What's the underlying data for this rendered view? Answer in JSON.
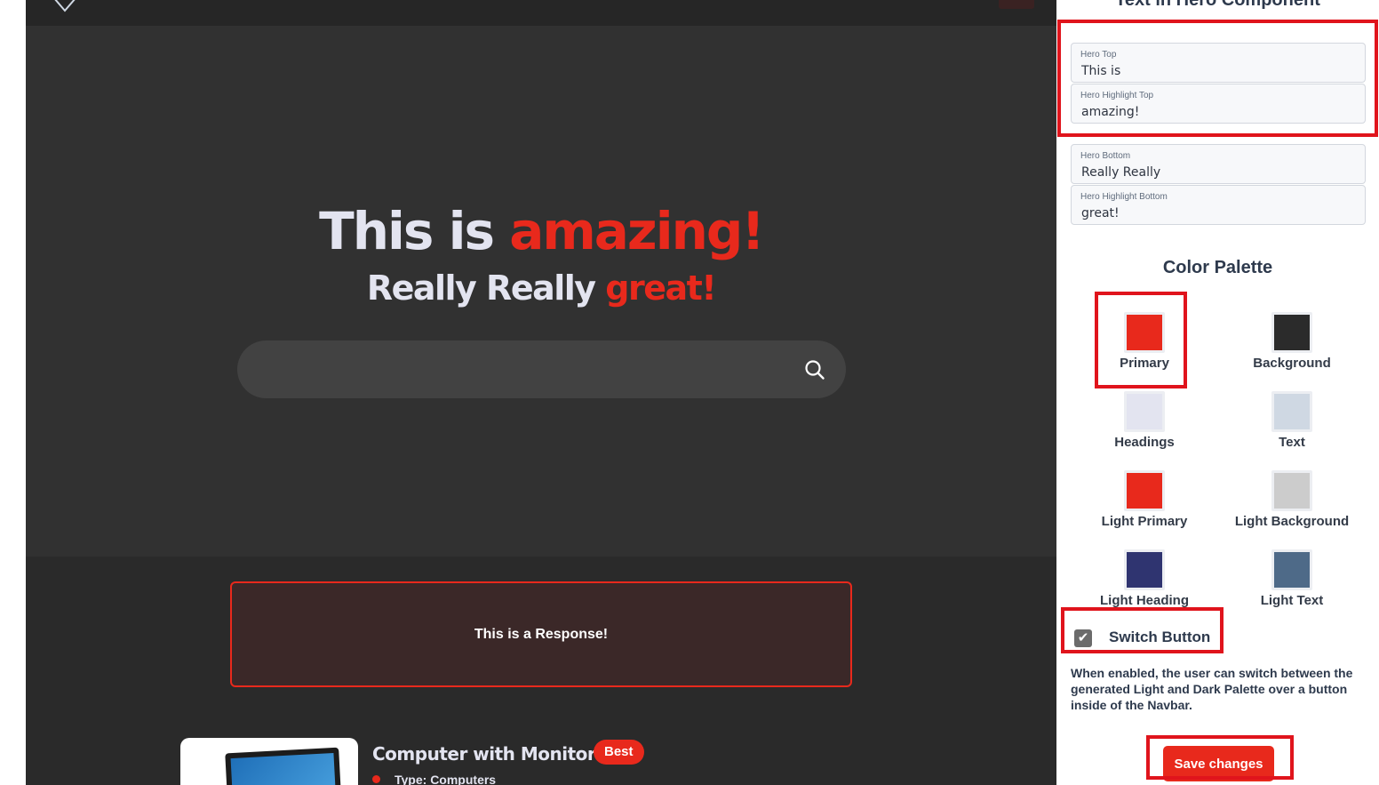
{
  "hero": {
    "top": "This is",
    "highlight_top": "amazing!",
    "bottom": "Really Really",
    "highlight_bottom": "great!"
  },
  "search": {
    "placeholder": ""
  },
  "response": {
    "text": "This is a Response!"
  },
  "product": {
    "title": "Computer with Monitor",
    "badge": "Best",
    "type": "Type: Computers"
  },
  "panel": {
    "title": "Text in Hero Component",
    "fields": [
      {
        "label": "Hero Top",
        "value": "This is"
      },
      {
        "label": "Hero Highlight Top",
        "value": "amazing!"
      },
      {
        "label": "Hero Bottom",
        "value": "Really Really"
      },
      {
        "label": "Hero Highlight Bottom",
        "value": "great!"
      }
    ],
    "palette_title": "Color Palette",
    "palette": [
      {
        "label": "Primary",
        "color": "#e8291c"
      },
      {
        "label": "Background",
        "color": "#2b2b2b"
      },
      {
        "label": "Headings",
        "color": "#e3e4f0"
      },
      {
        "label": "Text",
        "color": "#cfd8e3"
      },
      {
        "label": "Light Primary",
        "color": "#e8291c"
      },
      {
        "label": "Light Background",
        "color": "#cccccc"
      },
      {
        "label": "Light Heading",
        "color": "#2f3470"
      },
      {
        "label": "Light Text",
        "color": "#4e6a88"
      }
    ],
    "switch": {
      "label": "Switch Button",
      "checked": true
    },
    "help_text": "When enabled, the user can switch between the generated Light and Dark Palette over a button inside of the Navbar.",
    "save_label": "Save changes"
  },
  "colors": {
    "primary": "#e8291c",
    "background": "#2b2b2b",
    "annotation": "#e0141c"
  }
}
